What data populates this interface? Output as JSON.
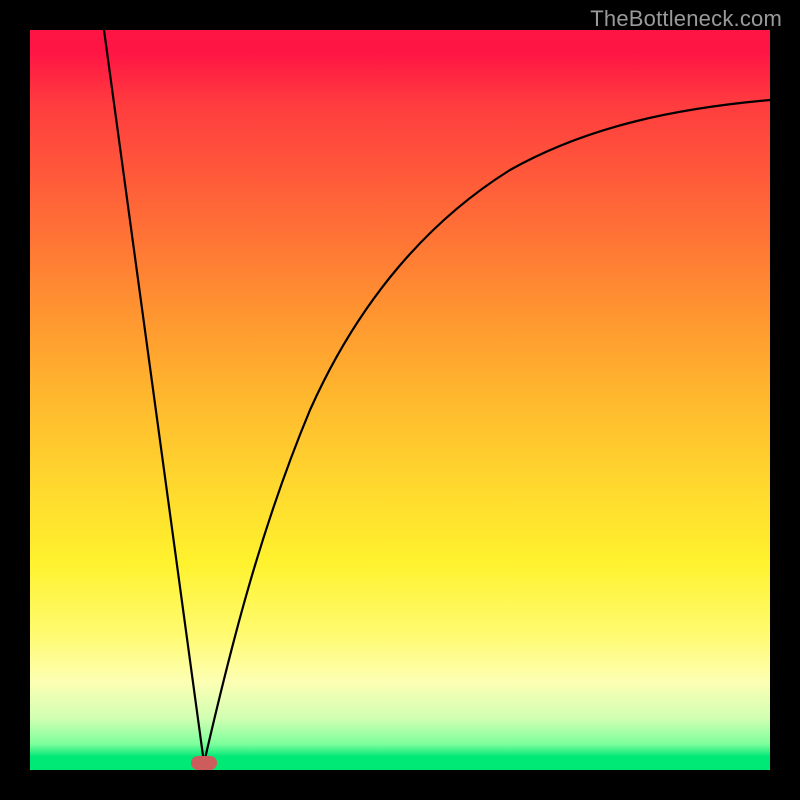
{
  "watermark": "TheBottleneck.com",
  "colors": {
    "frame_bg": "#000000",
    "gradient_top": "#ff1544",
    "gradient_mid": "#ffd92e",
    "gradient_bottom": "#00e876",
    "curve": "#000000",
    "marker": "#cd5d5d",
    "watermark_text": "#9a9a9a"
  },
  "chart_data": {
    "type": "line",
    "title": "",
    "xlabel": "",
    "ylabel": "",
    "xlim": [
      0,
      100
    ],
    "ylim": [
      0,
      100
    ],
    "series": [
      {
        "name": "left-branch",
        "x": [
          10,
          12,
          14,
          16,
          18,
          20,
          22,
          23.5
        ],
        "values": [
          100,
          93,
          85,
          72,
          57,
          40,
          20,
          1
        ]
      },
      {
        "name": "right-branch",
        "x": [
          23.5,
          25,
          27,
          30,
          33,
          37,
          42,
          48,
          55,
          63,
          72,
          82,
          92,
          100
        ],
        "values": [
          1,
          8,
          18,
          31,
          42,
          52,
          61,
          69,
          75,
          80,
          84,
          87,
          89,
          90
        ]
      }
    ],
    "marker": {
      "x": 23.5,
      "y": 1,
      "shape": "rounded-rect",
      "color": "#cd5d5d"
    }
  }
}
